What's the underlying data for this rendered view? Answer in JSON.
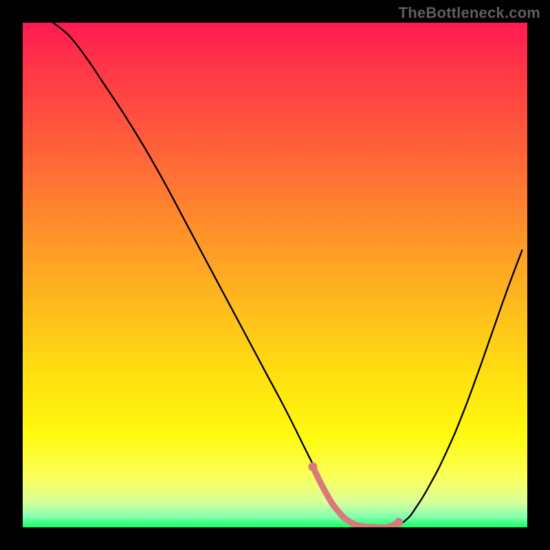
{
  "watermark": "TheBottleneck.com",
  "colors": {
    "frame": "#000000",
    "watermark": "#5e5e5e",
    "curve_stroke": "#000000",
    "trough_stroke": "#d87a7a",
    "trough_fill": "#d87a7a"
  },
  "chart_data": {
    "type": "line",
    "title": "",
    "xlabel": "",
    "ylabel": "",
    "xlim": [
      0,
      100
    ],
    "ylim": [
      0,
      100
    ],
    "x": [
      6,
      8,
      10,
      13,
      16,
      20,
      24,
      28,
      32,
      36,
      40,
      44,
      48,
      52,
      56,
      58,
      60,
      62,
      64,
      66,
      68,
      70,
      71.5,
      73,
      74,
      76,
      78,
      81,
      84,
      87,
      90,
      93,
      96,
      99
    ],
    "values": [
      100,
      98.5,
      96.5,
      92.5,
      88,
      82,
      75.5,
      68.5,
      61,
      53.5,
      46,
      38.5,
      31,
      23.5,
      15.5,
      11.5,
      7.5,
      4.5,
      2.2,
      0.9,
      0.2,
      0.0,
      0.0,
      0.0,
      0.3,
      1.5,
      4,
      9,
      15,
      22,
      30,
      38.5,
      47,
      55
    ],
    "trough": {
      "x": [
        57.5,
        60,
        62.5,
        65,
        67.5,
        70,
        72.5,
        74.5
      ],
      "values": [
        12,
        7,
        3.2,
        1.0,
        0.2,
        0.0,
        0.1,
        1.0
      ]
    },
    "grid": false,
    "legend": false
  }
}
